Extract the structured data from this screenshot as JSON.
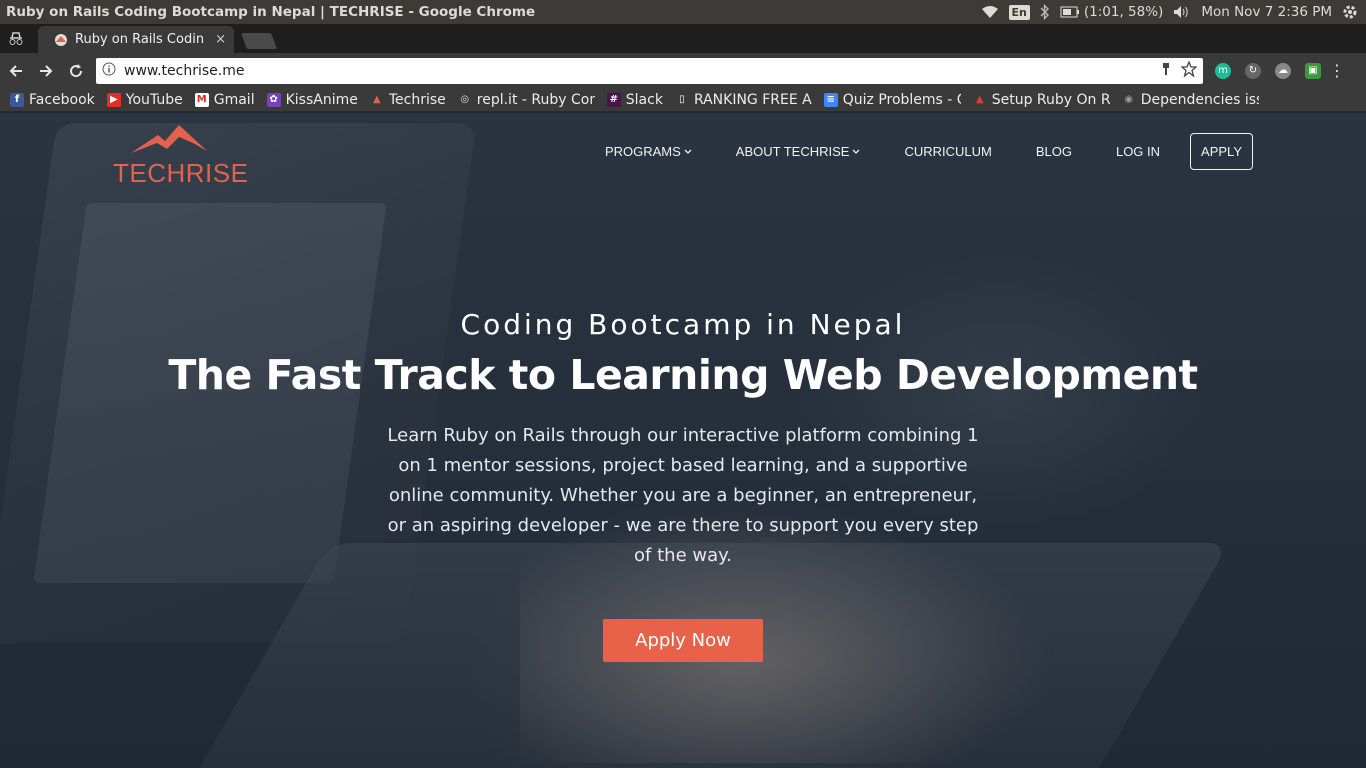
{
  "os_bar": {
    "window_title": "Ruby on Rails Coding Bootcamp in Nepal | TECHRISE - Google Chrome",
    "lang": "En",
    "battery": "(1:01, 58%)",
    "clock": "Mon Nov  7  2:36 PM"
  },
  "tab": {
    "title": "Ruby on Rails Codin",
    "close": "×"
  },
  "omnibox": {
    "url": "www.techrise.me"
  },
  "bookmarks": [
    {
      "label": "Facebook",
      "color": "#3b5998",
      "glyph": "f"
    },
    {
      "label": "YouTube",
      "color": "#e52d27",
      "glyph": "▶"
    },
    {
      "label": "Gmail",
      "color": "#d93025",
      "glyph": "M"
    },
    {
      "label": "KissAnime",
      "color": "#7a3fbf",
      "glyph": "✿"
    },
    {
      "label": "Techrise",
      "color": "#e2624b",
      "glyph": "▲"
    },
    {
      "label": "repl.it - Ruby Com",
      "color": "#555555",
      "glyph": "◎"
    },
    {
      "label": "Slack",
      "color": "#4a154b",
      "glyph": "#"
    },
    {
      "label": "RANKING FREE A",
      "color": "#ffffff",
      "glyph": "▯"
    },
    {
      "label": "Quiz Problems - C",
      "color": "#4285f4",
      "glyph": "≡"
    },
    {
      "label": "Setup Ruby On R",
      "color": "#c62828",
      "glyph": "▲"
    },
    {
      "label": "Dependencies iss",
      "color": "#444444",
      "glyph": "◉"
    }
  ],
  "site": {
    "logo_text": "TECHRISE",
    "brand_color": "#e8624a",
    "nav": {
      "programs": "PROGRAMS",
      "about": "ABOUT TECHRISE",
      "curriculum": "CURRICULUM",
      "blog": "BLOG",
      "login": "LOG IN",
      "apply": "APPLY"
    }
  },
  "hero": {
    "subtitle": "Coding Bootcamp in Nepal",
    "title": "The Fast Track to Learning Web Development",
    "description": "Learn Ruby on Rails through our interactive platform combining 1 on 1 mentor sessions, project based learning, and a supportive online community. Whether you are a beginner, an entrepreneur, or an aspiring developer - we are there to support you every step of the way.",
    "cta": "Apply Now"
  }
}
